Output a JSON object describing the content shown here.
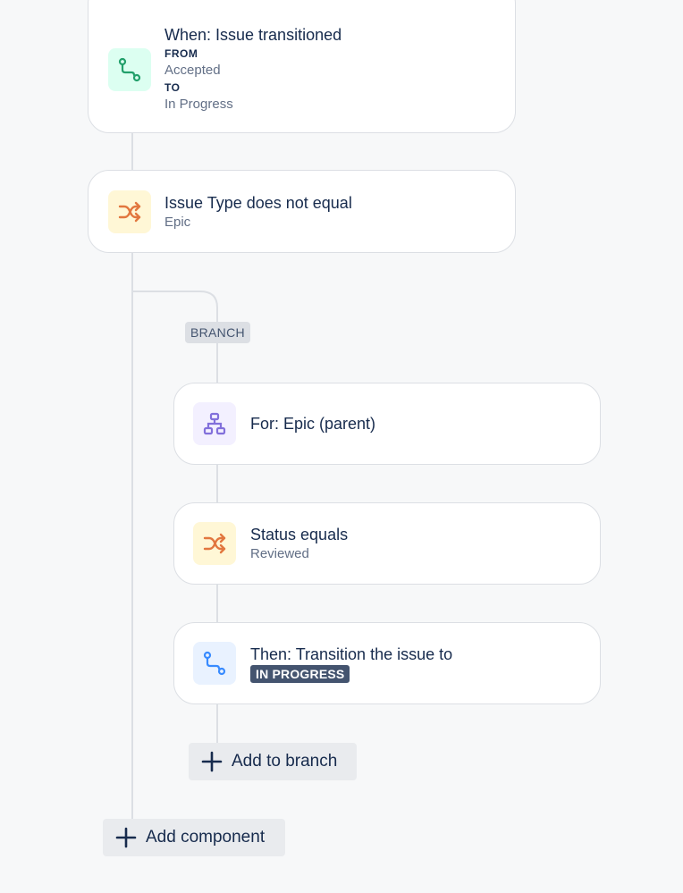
{
  "trigger": {
    "icon": "transition-icon",
    "title": "When: Issue transitioned",
    "from_label": "FROM",
    "from_value": "Accepted",
    "to_label": "TO",
    "to_value": "In Progress"
  },
  "condition": {
    "icon": "shuffle-icon",
    "title": "Issue Type does not equal",
    "value": "Epic"
  },
  "branch": {
    "tag": "BRANCH",
    "items": [
      {
        "icon": "hierarchy-icon",
        "title": "For: Epic (parent)"
      },
      {
        "icon": "shuffle-icon",
        "title": "Status equals",
        "value": "Reviewed"
      },
      {
        "icon": "transition-icon",
        "title": "Then: Transition the issue to",
        "lozenge": "IN PROGRESS"
      }
    ],
    "add_label": "Add to branch"
  },
  "add_component_label": "Add component",
  "colors": {
    "background": "#f7f8f9",
    "connector": "#dcdfe4",
    "green_icon": "#22a06b",
    "orange_icon": "#e2773f",
    "purple_icon": "#8270db",
    "blue_icon": "#388bff"
  }
}
